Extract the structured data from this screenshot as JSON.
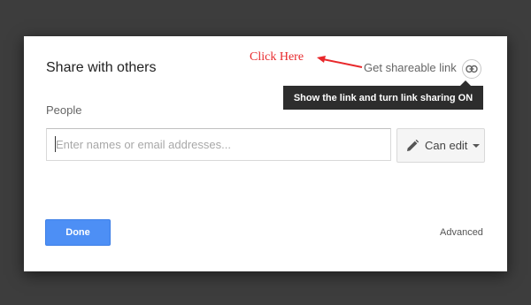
{
  "dialog": {
    "title": "Share with others",
    "annotation": "Click Here",
    "get_link_label": "Get shareable link",
    "link_icon": "link-icon",
    "tooltip": "Show the link and turn link sharing ON",
    "people_label": "People",
    "people_input": {
      "value": "",
      "placeholder": "Enter names or email addresses..."
    },
    "permission": {
      "icon": "pencil-icon",
      "label": "Can edit"
    },
    "done_label": "Done",
    "advanced_label": "Advanced"
  },
  "colors": {
    "backdrop": "#3d3d3d",
    "annotation_red": "#e8282b",
    "done_blue": "#4d8ff5",
    "tooltip_bg": "#2d2d2d"
  }
}
